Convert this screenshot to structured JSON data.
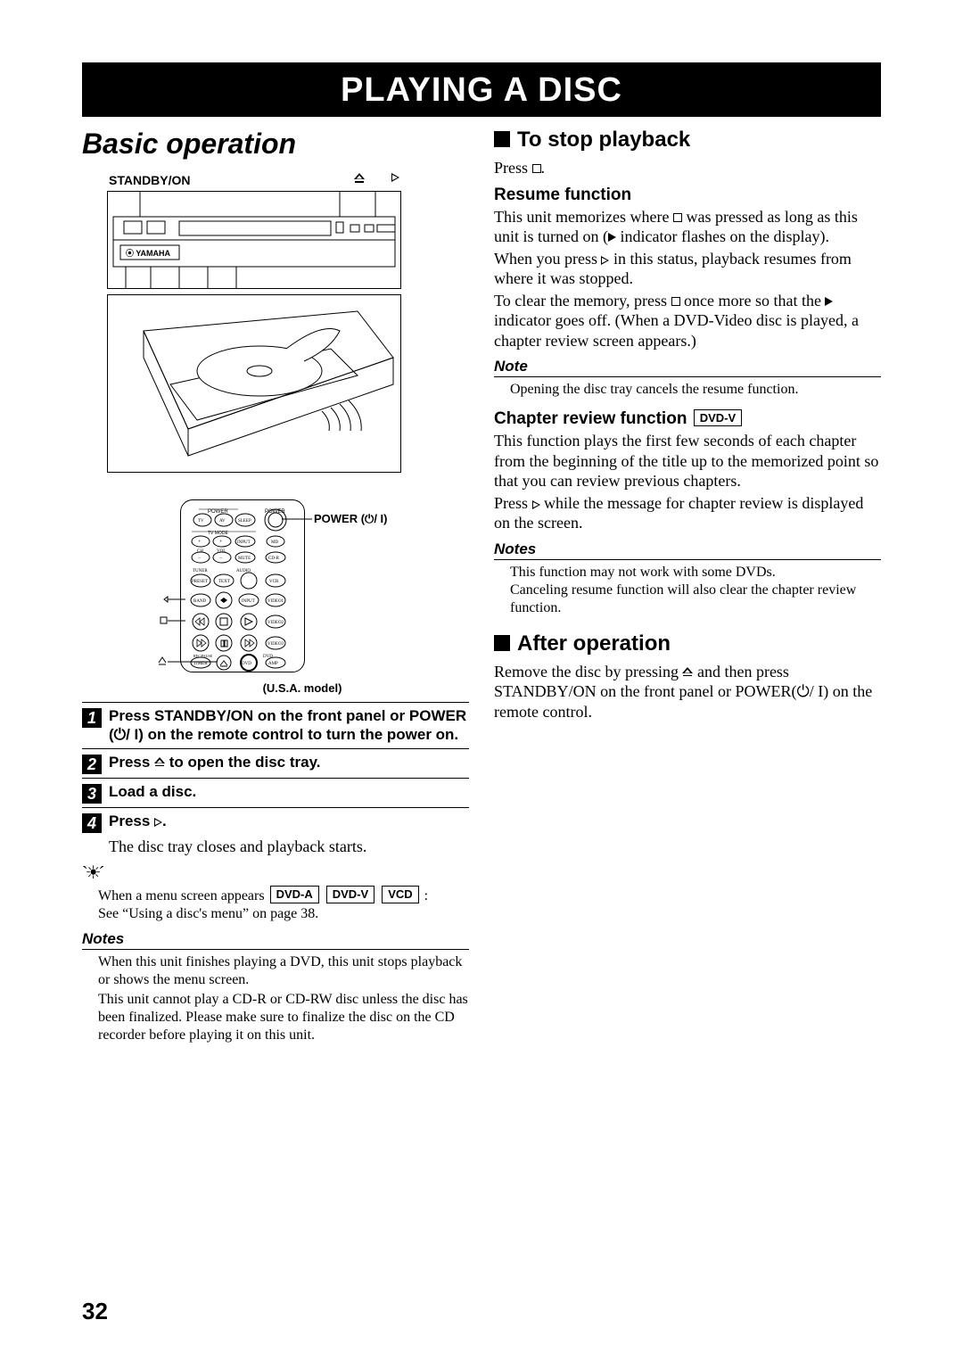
{
  "page_number": "32",
  "title": "PLAYING A DISC",
  "section_title": "Basic operation",
  "front_panel": {
    "standby_label": "STANDBY/ON",
    "brand": "YAMAHA"
  },
  "remote": {
    "power_label": "POWER (⏻/ I)",
    "model_note": "(U.S.A. model)"
  },
  "steps": {
    "s1": "Press STANDBY/ON on the front panel or POWER (⏻/ I) on the remote control to turn the power on.",
    "s2_pre": "Press ",
    "s2_post": " to open the disc tray.",
    "s3": "Load a disc.",
    "s4_pre": "Press ",
    "s4_post": ".",
    "s4_body": "The disc tray closes and playback starts."
  },
  "tip": {
    "line1_pre": "When a menu screen appears ",
    "badges": [
      "DVD-A",
      "DVD-V",
      "VCD"
    ],
    "line1_post": " :",
    "line2": "See “Using a disc's menu” on page 38."
  },
  "left_notes": {
    "label": "Notes",
    "n1": "When this unit finishes playing a DVD, this unit stops playback or shows the menu screen.",
    "n2": "This unit cannot play a CD-R or CD-RW disc unless the disc has been finalized. Please make sure to finalize the disc on the CD recorder before playing it on this unit."
  },
  "right": {
    "stop_title": "To stop playback",
    "stop_press_pre": "Press ",
    "stop_press_post": ".",
    "resume_head": "Resume function",
    "resume_p1_a": "This unit memorizes where ",
    "resume_p1_b": " was pressed as long as this unit is turned on (",
    "resume_p1_c": " indicator flashes on the display).",
    "resume_p2_a": "When you press ",
    "resume_p2_b": " in this status, playback resumes from where it was stopped.",
    "resume_p3_a": "To clear the memory, press ",
    "resume_p3_b": " once more so that the ",
    "resume_p3_c": " indicator goes off. (When a DVD-Video disc is played, a chapter review screen appears.)",
    "note1_label": "Note",
    "note1_body": "Opening the disc tray cancels the resume function.",
    "chap_head_pre": "Chapter review function ",
    "chap_badge": "DVD-V",
    "chap_p1": "This function plays the first few seconds of each chapter from the beginning of the title up to the memorized point so that you can review previous chapters.",
    "chap_p2_a": "Press ",
    "chap_p2_b": " while the message for chapter review is displayed on the screen.",
    "notes2_label": "Notes",
    "notes2_n1": "This function may not work with some DVDs.",
    "notes2_n2": "Canceling resume function will also clear the chapter review function.",
    "after_title": "After operation",
    "after_p_a": "Remove the disc by pressing ",
    "after_p_b": " and then press STANDBY/ON on the front panel or POWER(⏻/ I) on the remote control."
  }
}
